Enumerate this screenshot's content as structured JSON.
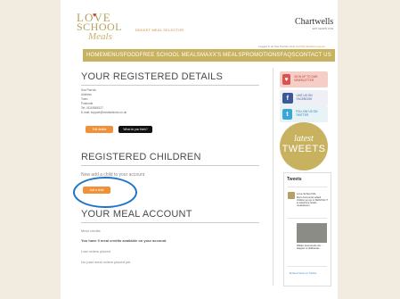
{
  "logo": {
    "line1": "LOVE",
    "line2": "SCHOOL",
    "line3": "Meals",
    "tagline": "DEKKET MEAL SELECTOR"
  },
  "brand": {
    "name": "Chartwells",
    "sub": "EAT LEARN LIVE"
  },
  "account_links": {
    "prefix": "Logged in as Sue Parrots",
    "links": "View Cart   My account   Log out"
  },
  "nav": [
    "HOME",
    "MENUS",
    "FOOD",
    "FREE SCHOOL MEALS",
    "MAXX'S MEALS",
    "PROMOTIONS",
    "FAQS",
    "CONTACT US"
  ],
  "registered_details": {
    "title": "YOUR REGISTERED DETAILS",
    "lines": [
      "Sue Parrots",
      "Address",
      "Town",
      "Postcode",
      "Tel: 01119565127",
      "E-mail: support@mealselector.co.uk"
    ],
    "edit_label": "Edit details",
    "what_label": "What do you think?"
  },
  "children": {
    "title": "REGISTERED CHILDREN",
    "prompt": "Now add a child to your account",
    "add_label": "Add a child"
  },
  "meal_account": {
    "title": "YOUR MEAL ACCOUNT",
    "credits_label": "Meal credits",
    "credits_text": "You have 0 meal credits available on your account",
    "last_label": "Last orders placed",
    "last_text": "No past meal orders placed yet"
  },
  "social": {
    "signup": "SIGN UP TO OUR NEWSLETTER",
    "facebook": "LIKE US ON FACEBOOK",
    "twitter": "FOLLOW US ON TWITTER"
  },
  "tweets_badge": {
    "a": "latest",
    "b": "TWEETS"
  },
  "feed": {
    "head": "Tweets",
    "user": "Love School Me",
    "text": "More documents added children get go to SERVICE IT at telephone details mealselector",
    "caption": "Walter documents am... Happen a deliberate...",
    "links": "Embed    View on Twitter"
  },
  "colors": {
    "accent": "#c8b25f",
    "button": "#f0913a",
    "highlight_circle": "#1f74c7"
  }
}
